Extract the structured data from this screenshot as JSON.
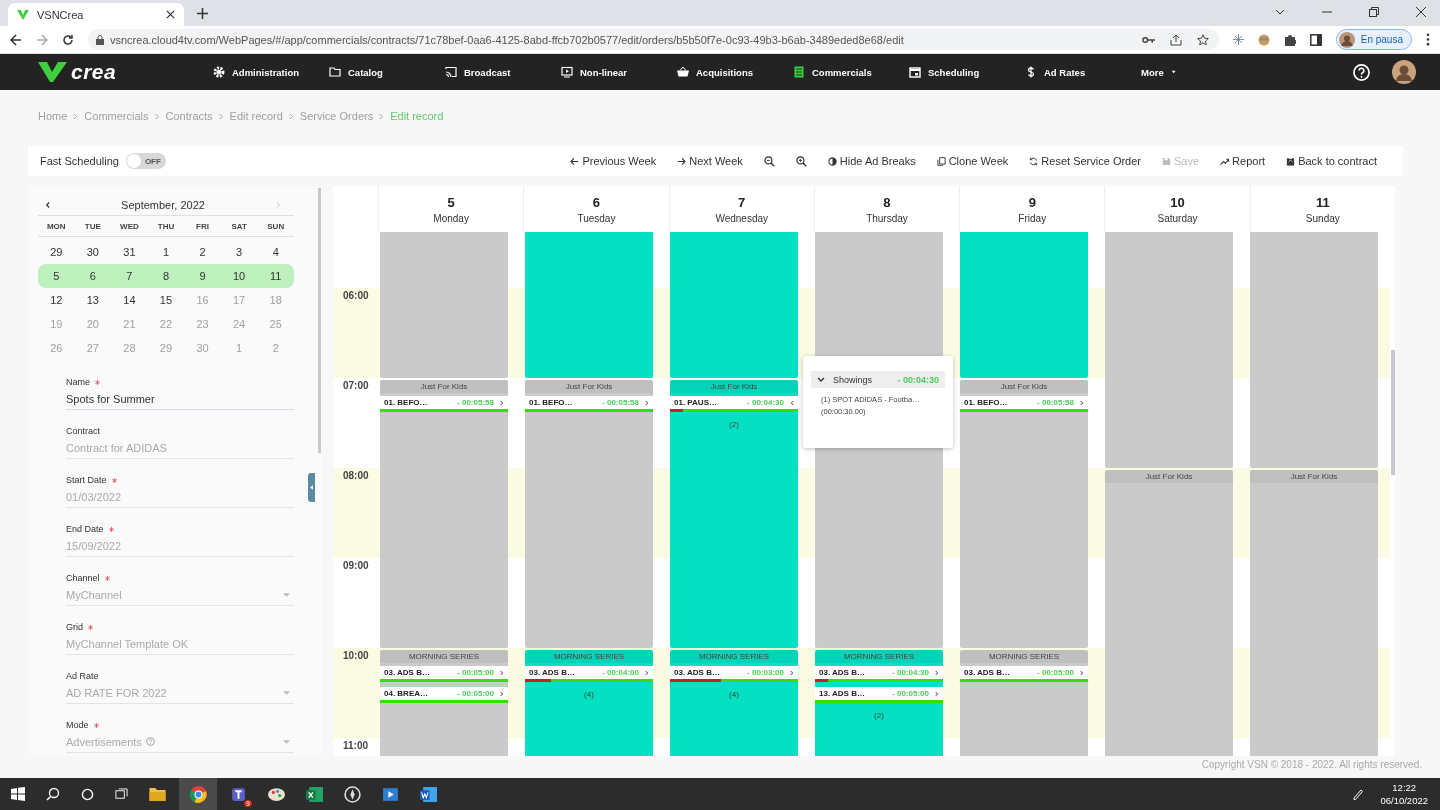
{
  "browser": {
    "tab_title": "VSNCrea",
    "url": "vsncrea.cloud4tv.com/WebPages/#/app/commercials/contracts/71c78bef-0aa6-4125-8abd-ffcb702b0577/edit/orders/b5b50f7e-0c93-49b3-b6ab-3489eded8e68/edit",
    "profile_status": "En pausa"
  },
  "nav": {
    "logo": "crea",
    "items": [
      {
        "label": "Administration",
        "selected": false
      },
      {
        "label": "Catalog",
        "selected": false
      },
      {
        "label": "Broadcast",
        "selected": false
      },
      {
        "label": "Non-linear",
        "selected": false
      },
      {
        "label": "Acquisitions",
        "selected": false
      },
      {
        "label": "Commercials",
        "selected": true
      },
      {
        "label": "Scheduling",
        "selected": false
      },
      {
        "label": "Ad Rates",
        "selected": false
      },
      {
        "label": "More",
        "selected": false
      }
    ]
  },
  "breadcrumb": [
    {
      "label": "Home",
      "selected": false
    },
    {
      "label": "Commercials",
      "selected": false
    },
    {
      "label": "Contracts",
      "selected": false
    },
    {
      "label": "Edit record",
      "selected": false
    },
    {
      "label": "Service Orders",
      "selected": false
    },
    {
      "label": "Edit record",
      "selected": true
    }
  ],
  "fast_scheduling": {
    "label": "Fast Scheduling",
    "on": false,
    "state_label": "OFF"
  },
  "toolbar": [
    {
      "label": "Previous Week",
      "disabled": false
    },
    {
      "label": "Next Week",
      "disabled": false
    },
    {
      "label": "Hide Ad Breaks",
      "disabled": false
    },
    {
      "label": "Clone Week",
      "disabled": false
    },
    {
      "label": "Reset Service Order",
      "disabled": false
    },
    {
      "label": "Save",
      "disabled": true
    },
    {
      "label": "Report",
      "disabled": false
    },
    {
      "label": "Back to contract",
      "disabled": false
    }
  ],
  "mini_calendar": {
    "month": "September, 2022",
    "weekdays": [
      "MON",
      "TUE",
      "WED",
      "THU",
      "FRI",
      "SAT",
      "SUN"
    ],
    "weeks": [
      {
        "selected": false,
        "days": [
          {
            "day": "29",
            "disabled": false
          },
          {
            "day": "30",
            "disabled": false
          },
          {
            "day": "31",
            "disabled": false
          },
          {
            "day": "1",
            "disabled": false
          },
          {
            "day": "2",
            "disabled": false
          },
          {
            "day": "3",
            "disabled": false
          },
          {
            "day": "4",
            "disabled": false
          }
        ]
      },
      {
        "selected": true,
        "days": [
          {
            "day": "5",
            "disabled": false
          },
          {
            "day": "6",
            "disabled": false
          },
          {
            "day": "7",
            "disabled": false
          },
          {
            "day": "8",
            "disabled": false
          },
          {
            "day": "9",
            "disabled": false
          },
          {
            "day": "10",
            "disabled": false
          },
          {
            "day": "11",
            "disabled": false
          }
        ]
      },
      {
        "selected": false,
        "days": [
          {
            "day": "12",
            "disabled": false
          },
          {
            "day": "13",
            "disabled": false
          },
          {
            "day": "14",
            "disabled": false
          },
          {
            "day": "15",
            "disabled": false
          },
          {
            "day": "16",
            "disabled": true
          },
          {
            "day": "17",
            "disabled": true
          },
          {
            "day": "18",
            "disabled": true
          }
        ]
      },
      {
        "selected": false,
        "days": [
          {
            "day": "19",
            "disabled": true
          },
          {
            "day": "20",
            "disabled": true
          },
          {
            "day": "21",
            "disabled": true
          },
          {
            "day": "22",
            "disabled": true
          },
          {
            "day": "23",
            "disabled": true
          },
          {
            "day": "24",
            "disabled": true
          },
          {
            "day": "25",
            "disabled": true
          }
        ]
      },
      {
        "selected": false,
        "days": [
          {
            "day": "26",
            "disabled": true
          },
          {
            "day": "27",
            "disabled": true
          },
          {
            "day": "28",
            "disabled": true
          },
          {
            "day": "29",
            "disabled": true
          },
          {
            "day": "30",
            "disabled": true
          },
          {
            "day": "1",
            "disabled": true
          },
          {
            "day": "2",
            "disabled": true
          }
        ]
      }
    ]
  },
  "form": [
    {
      "label": "Name",
      "required": true,
      "value": "Spots for Summer",
      "disabled": false,
      "kind": "text",
      "help": false
    },
    {
      "label": "Contract",
      "required": false,
      "value": "Contract for ADIDAS",
      "disabled": true,
      "kind": "text",
      "help": false
    },
    {
      "label": "Start Date",
      "required": true,
      "value": "01/03/2022",
      "disabled": true,
      "kind": "text",
      "help": false
    },
    {
      "label": "End Date",
      "required": true,
      "value": "15/09/2022",
      "disabled": true,
      "kind": "text",
      "help": false
    },
    {
      "label": "Channel",
      "required": true,
      "value": "MyChannel",
      "disabled": true,
      "kind": "select",
      "help": false
    },
    {
      "label": "Grid",
      "required": true,
      "value": "MyChannel Template OK",
      "disabled": true,
      "kind": "text",
      "help": false
    },
    {
      "label": "Ad Rate",
      "required": false,
      "value": "AD RATE FOR 2022",
      "disabled": true,
      "kind": "select",
      "help": false
    },
    {
      "label": "Mode",
      "required": true,
      "value": "Advertisements",
      "disabled": true,
      "kind": "select",
      "help": true
    }
  ],
  "schedule": {
    "days": [
      {
        "number": "5",
        "weekday": "Monday"
      },
      {
        "number": "6",
        "weekday": "Tuesday"
      },
      {
        "number": "7",
        "weekday": "Wednesday"
      },
      {
        "number": "8",
        "weekday": "Thursday"
      },
      {
        "number": "9",
        "weekday": "Friday"
      },
      {
        "number": "10",
        "weekday": "Saturday"
      },
      {
        "number": "11",
        "weekday": "Sunday"
      }
    ],
    "leading_blocks": [
      {
        "filled": false
      },
      {
        "filled": true
      },
      {
        "filled": true
      },
      {
        "filled": false
      },
      {
        "filled": true
      },
      {
        "filled": false
      },
      {
        "filled": false
      }
    ],
    "hours": [
      {
        "label": "06:00"
      },
      {
        "label": "07:00",
        "blocks": [
          {
            "kind": "block",
            "filled": false,
            "title": "Just For Kids",
            "breaks": [
              {
                "name": "01. BEFO…",
                "time": "- 00:05:58",
                "level": 0,
                "expanded": false
              }
            ]
          },
          {
            "kind": "block",
            "filled": false,
            "title": "Just For Kids",
            "breaks": [
              {
                "name": "01. BEFO…",
                "time": "- 00:05:58",
                "level": 0,
                "expanded": false
              }
            ]
          },
          {
            "kind": "block",
            "filled": true,
            "title": "Just For Kids",
            "breaks": [
              {
                "name": "01. PAUS…",
                "time": "- 00:04:30",
                "level": 0.1,
                "expanded": true
              }
            ],
            "count": "(2)"
          },
          {
            "kind": "block",
            "filled": false
          },
          {
            "kind": "block",
            "filled": false,
            "title": "Just For Kids",
            "breaks": [
              {
                "name": "01. BEFO…",
                "time": "- 00:05:58",
                "level": 0,
                "expanded": false
              }
            ]
          },
          {
            "kind": "continued"
          },
          {
            "kind": "continued"
          }
        ]
      },
      {
        "label": "08:00",
        "blocks": [
          {
            "kind": "continued"
          },
          {
            "kind": "continued"
          },
          {
            "kind": "continued"
          },
          {
            "kind": "continued"
          },
          {
            "kind": "continued"
          },
          {
            "kind": "block",
            "filled": false,
            "title": "Just For Kids"
          },
          {
            "kind": "block",
            "filled": false,
            "title": "Just For Kids"
          }
        ]
      },
      {
        "label": "09:00"
      },
      {
        "label": "10:00",
        "blocks": [
          {
            "kind": "block",
            "filled": false,
            "title": "MORNING SERIES",
            "breaks": [
              {
                "name": "03. ADS B…",
                "time": "- 00:05:00",
                "level": 0,
                "expanded": false
              },
              {
                "name": "04. BREA…",
                "time": "- 00:05:00",
                "level": 0,
                "expanded": false
              }
            ]
          },
          {
            "kind": "block",
            "filled": true,
            "title": "MORNING SERIES",
            "breaks": [
              {
                "name": "03. ADS B…",
                "time": "- 00:04:00",
                "level": 0.2,
                "expanded": false
              }
            ],
            "count": "(4)"
          },
          {
            "kind": "block",
            "filled": true,
            "title": "MORNING SERIES",
            "breaks": [
              {
                "name": "03. ADS B…",
                "time": "- 00:03:00",
                "level": 0.4,
                "expanded": false
              }
            ],
            "count": "(4)"
          },
          {
            "kind": "block",
            "filled": true,
            "title": "MORNING SERIES",
            "breaks": [
              {
                "name": "03. ADS B…",
                "time": "- 00:04:30",
                "level": 0.1,
                "expanded": false
              },
              {
                "name": "13. ADS B…",
                "time": "- 00:05:00",
                "level": 0,
                "expanded": false
              }
            ],
            "count": "(2)"
          },
          {
            "kind": "block",
            "filled": false,
            "title": "MORNING SERIES",
            "breaks": [
              {
                "name": "03. ADS B…",
                "time": "- 00:05:00",
                "level": 0,
                "expanded": false
              }
            ]
          },
          {
            "kind": "continued"
          },
          {
            "kind": "continued"
          }
        ]
      },
      {
        "label": "11:00"
      }
    ]
  },
  "popup": {
    "title": "Showings",
    "time": "- 00:04:30",
    "items": [
      {
        "name": "(1) SPOT ADIDAS - Footba…",
        "duration": "(00:00:30.00)"
      }
    ]
  },
  "footer": "Copyright VSN © 2018 - 2022. All rights reserved.",
  "taskbar": {
    "badge": "9",
    "time": "12:22",
    "date": "06/10/2022"
  }
}
